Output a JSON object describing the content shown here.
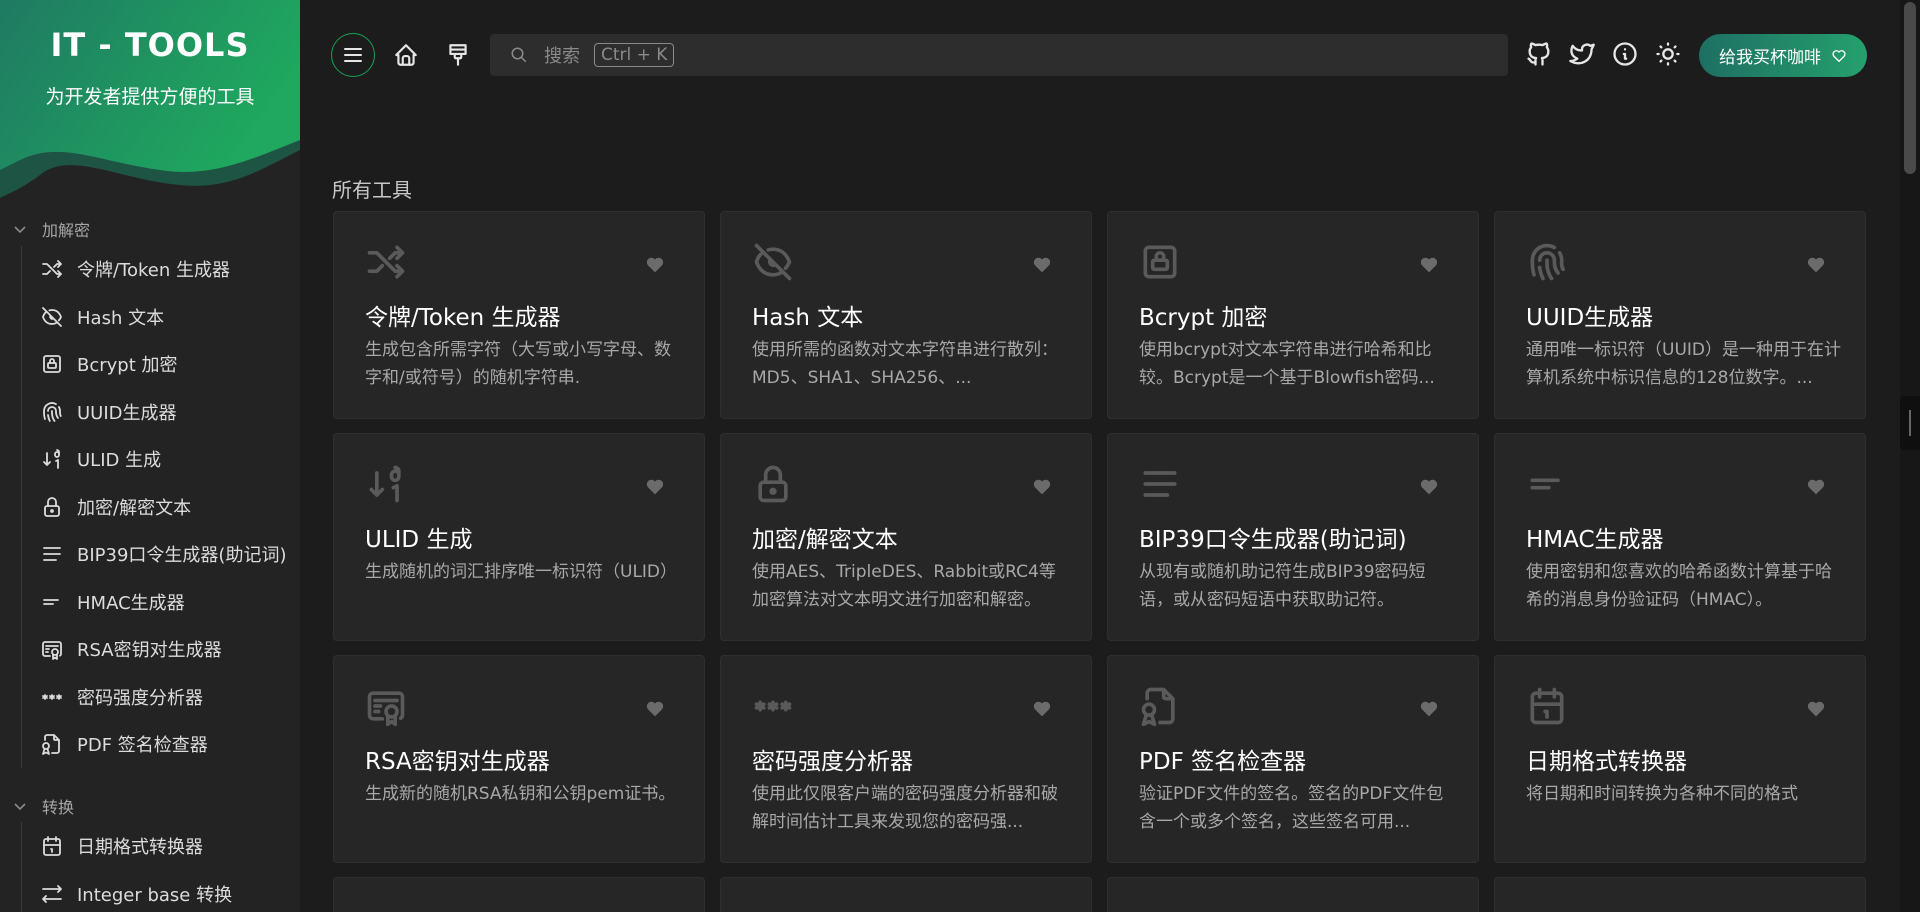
{
  "brand": {
    "title": "IT - TOOLS",
    "subtitle": "为开发者提供方便的工具"
  },
  "sidebar": {
    "groups": [
      {
        "label": "加解密"
      },
      {
        "label": "转换"
      }
    ],
    "items": [
      {
        "label": "令牌/Token 生成器",
        "icon": "shuffle-icon"
      },
      {
        "label": "Hash 文本",
        "icon": "eye-off-icon"
      },
      {
        "label": "Bcrypt 加密",
        "icon": "lock-square-icon"
      },
      {
        "label": "UUID生成器",
        "icon": "fingerprint-icon"
      },
      {
        "label": "ULID 生成",
        "icon": "sort-numeric-icon"
      },
      {
        "label": "加密/解密文本",
        "icon": "lock-icon"
      },
      {
        "label": "BIP39口令生成器(助记词)",
        "icon": "align-justified-icon"
      },
      {
        "label": "HMAC生成器",
        "icon": "short-text-icon"
      },
      {
        "label": "RSA密钥对生成器",
        "icon": "certificate-icon"
      },
      {
        "label": "密码强度分析器",
        "icon": "password-icon"
      },
      {
        "label": "PDF 签名检查器",
        "icon": "file-cert-icon"
      },
      {
        "label": "日期格式转换器",
        "icon": "calendar-icon"
      },
      {
        "label": "Integer base 转换",
        "icon": "arrows-left-right-icon"
      }
    ]
  },
  "header": {
    "search_placeholder": "搜索",
    "search_shortcut": "Ctrl + K",
    "coffee_label": "给我买杯咖啡"
  },
  "main": {
    "section_title": "所有工具",
    "cards": [
      {
        "title": "令牌/Token 生成器",
        "desc": "生成包含所需字符（大写或小写字母、数字和/或符号）的随机字符串.",
        "icon": "shuffle-icon"
      },
      {
        "title": "Hash 文本",
        "desc": "使用所需的函数对文本字符串进行散列：MD5、SHA1、SHA256、...",
        "icon": "eye-off-icon"
      },
      {
        "title": "Bcrypt 加密",
        "desc": "使用bcrypt对文本字符串进行哈希和比较。Bcrypt是一个基于Blowfish密码...",
        "icon": "lock-square-icon"
      },
      {
        "title": "UUID生成器",
        "desc": "通用唯一标识符（UUID）是一种用于在计算机系统中标识信息的128位数字。...",
        "icon": "fingerprint-icon"
      },
      {
        "title": "ULID 生成",
        "desc": "生成随机的词汇排序唯一标识符（ULID）",
        "icon": "sort-numeric-icon"
      },
      {
        "title": "加密/解密文本",
        "desc": "使用AES、TripleDES、Rabbit或RC4等加密算法对文本明文进行加密和解密。",
        "icon": "lock-icon"
      },
      {
        "title": "BIP39口令生成器(助记词)",
        "desc": "从现有或随机助记符生成BIP39密码短语，或从密码短语中获取助记符。",
        "icon": "align-justified-icon"
      },
      {
        "title": "HMAC生成器",
        "desc": "使用密钥和您喜欢的哈希函数计算基于哈希的消息身份验证码（HMAC）。",
        "icon": "short-text-icon"
      },
      {
        "title": "RSA密钥对生成器",
        "desc": "生成新的随机RSA私钥和公钥pem证书。",
        "icon": "certificate-icon"
      },
      {
        "title": "密码强度分析器",
        "desc": "使用此仅限客户端的密码强度分析器和破解时间估计工具来发现您的密码强...",
        "icon": "password-icon"
      },
      {
        "title": "PDF 签名检查器",
        "desc": "验证PDF文件的签名。签名的PDF文件包含一个或多个签名，这些签名可用...",
        "icon": "file-cert-icon"
      },
      {
        "title": "日期格式转换器",
        "desc": "将日期和时间转换为各种不同的格式",
        "icon": "calendar-icon"
      }
    ]
  },
  "colors": {
    "accent": "#18a058",
    "background": "#1c1c1c",
    "card": "#262626",
    "sidebar": "#232323"
  }
}
